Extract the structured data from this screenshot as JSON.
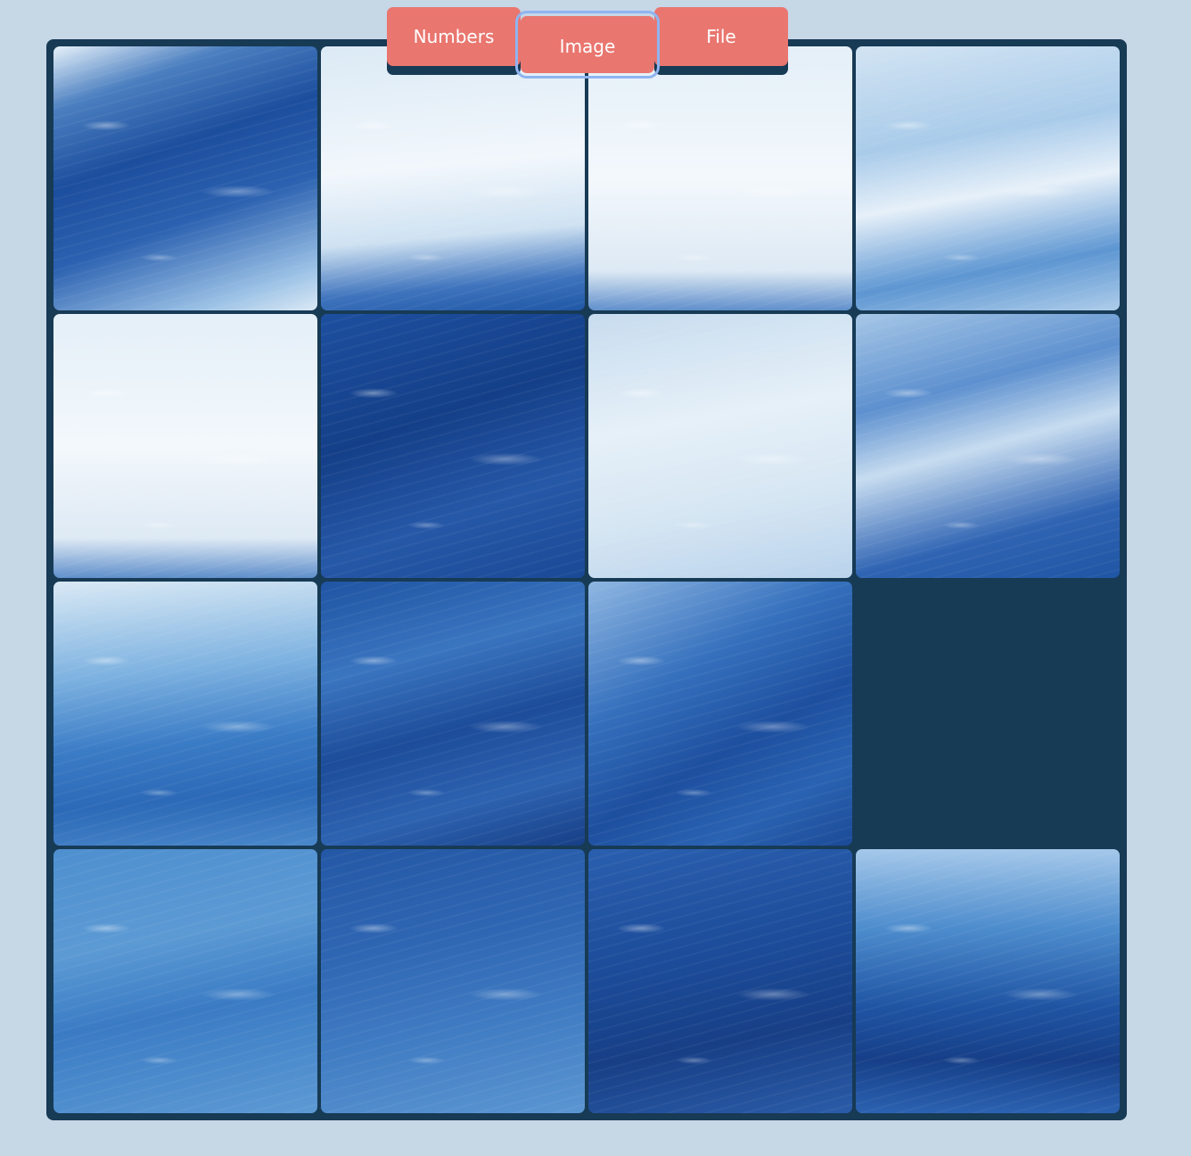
{
  "modes": {
    "numbers_label": "Numbers",
    "image_label": "Image",
    "file_label": "File",
    "selected": "Image"
  },
  "colors": {
    "page_background": "#c6d7e6",
    "board_background": "#173a55",
    "tab_color": "#e9766f",
    "tab_text": "#ffffff",
    "focus_ring": "#8fb4f0"
  },
  "puzzle": {
    "grid_size": 4,
    "image_subject": "ocean waves",
    "empty_cell": {
      "row": 3,
      "col": 4
    },
    "tiles": [
      {
        "row": 1,
        "col": 1,
        "tone": "deep-blue-foam"
      },
      {
        "row": 1,
        "col": 2,
        "tone": "white-foam-crest"
      },
      {
        "row": 1,
        "col": 3,
        "tone": "white-foam"
      },
      {
        "row": 1,
        "col": 4,
        "tone": "light-blue-streaks"
      },
      {
        "row": 2,
        "col": 1,
        "tone": "white-foam"
      },
      {
        "row": 2,
        "col": 2,
        "tone": "deep-blue"
      },
      {
        "row": 2,
        "col": 3,
        "tone": "light-foam"
      },
      {
        "row": 2,
        "col": 4,
        "tone": "blue-streaks"
      },
      {
        "row": 3,
        "col": 1,
        "tone": "light-blue-swirl"
      },
      {
        "row": 3,
        "col": 2,
        "tone": "deep-blue-swirl"
      },
      {
        "row": 3,
        "col": 3,
        "tone": "blue-wave-crest"
      },
      {
        "row": 4,
        "col": 1,
        "tone": "mid-blue"
      },
      {
        "row": 4,
        "col": 2,
        "tone": "mid-blue-dark"
      },
      {
        "row": 4,
        "col": 3,
        "tone": "deep-blue-spray"
      },
      {
        "row": 4,
        "col": 4,
        "tone": "light-to-deep-blue"
      }
    ]
  }
}
